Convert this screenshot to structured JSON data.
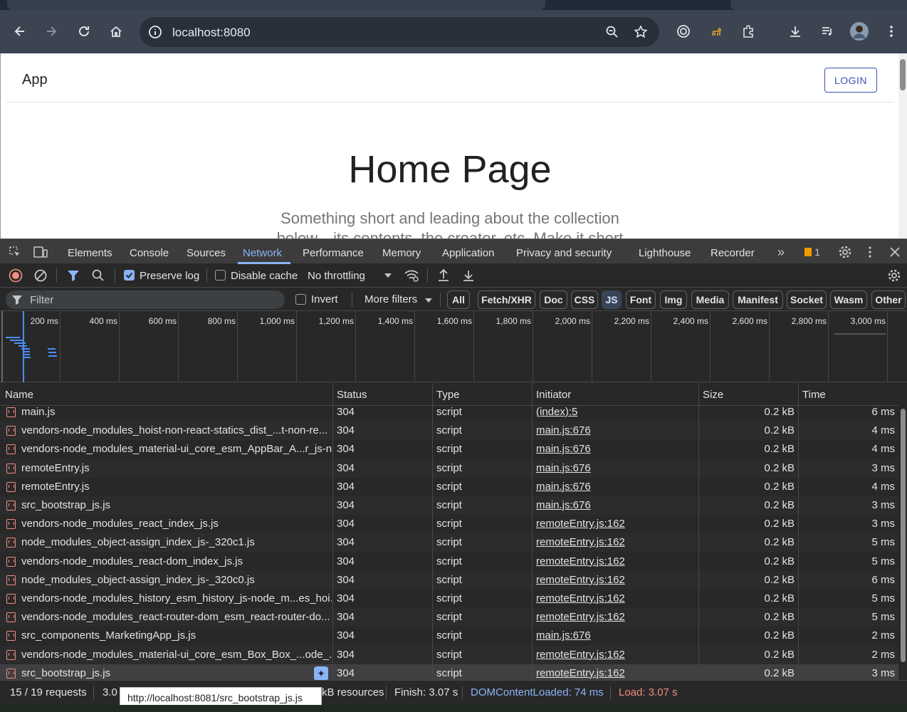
{
  "browser": {
    "url": "localhost:8080"
  },
  "page": {
    "app_title": "App",
    "login_label": "LOGIN",
    "heading": "Home Page",
    "subtitle": "Something short and leading about the collection below—its contents, the creator, etc. Make it short"
  },
  "devtools": {
    "tabs": [
      "Elements",
      "Console",
      "Sources",
      "Network",
      "Performance",
      "Memory",
      "Application",
      "Privacy and security",
      "Lighthouse",
      "Recorder"
    ],
    "active_tab": "Network",
    "issues_count": "1",
    "toolbar": {
      "preserve_log": "Preserve log",
      "disable_cache": "Disable cache",
      "throttling": "No throttling"
    },
    "filter": {
      "placeholder": "Filter",
      "invert": "Invert",
      "more_filters": "More filters",
      "types": [
        "All",
        "Fetch/XHR",
        "Doc",
        "CSS",
        "JS",
        "Font",
        "Img",
        "Media",
        "Manifest",
        "Socket",
        "Wasm",
        "Other"
      ],
      "active_type": "JS"
    },
    "timeline_labels": [
      "200 ms",
      "400 ms",
      "600 ms",
      "800 ms",
      "1,000 ms",
      "1,200 ms",
      "1,400 ms",
      "1,600 ms",
      "1,800 ms",
      "2,000 ms",
      "2,200 ms",
      "2,400 ms",
      "2,600 ms",
      "2,800 ms",
      "3,000 ms"
    ],
    "columns": {
      "name": "Name",
      "status": "Status",
      "type": "Type",
      "initiator": "Initiator",
      "size": "Size",
      "time": "Time"
    },
    "rows": [
      {
        "name": "main.js",
        "status": "304",
        "type": "script",
        "initiator": "(index):5",
        "size": "0.2 kB",
        "time": "6 ms"
      },
      {
        "name": "vendors-node_modules_hoist-non-react-statics_dist_...t-non-re...",
        "status": "304",
        "type": "script",
        "initiator": "main.js:676",
        "size": "0.2 kB",
        "time": "4 ms"
      },
      {
        "name": "vendors-node_modules_material-ui_core_esm_AppBar_A...r_js-n...",
        "status": "304",
        "type": "script",
        "initiator": "main.js:676",
        "size": "0.2 kB",
        "time": "4 ms"
      },
      {
        "name": "remoteEntry.js",
        "status": "304",
        "type": "script",
        "initiator": "main.js:676",
        "size": "0.2 kB",
        "time": "3 ms"
      },
      {
        "name": "remoteEntry.js",
        "status": "304",
        "type": "script",
        "initiator": "main.js:676",
        "size": "0.2 kB",
        "time": "4 ms"
      },
      {
        "name": "src_bootstrap_js.js",
        "status": "304",
        "type": "script",
        "initiator": "main.js:676",
        "size": "0.2 kB",
        "time": "3 ms"
      },
      {
        "name": "vendors-node_modules_react_index_js.js",
        "status": "304",
        "type": "script",
        "initiator": "remoteEntry.js:162",
        "size": "0.2 kB",
        "time": "3 ms"
      },
      {
        "name": "node_modules_object-assign_index_js-_320c1.js",
        "status": "304",
        "type": "script",
        "initiator": "remoteEntry.js:162",
        "size": "0.2 kB",
        "time": "5 ms"
      },
      {
        "name": "vendors-node_modules_react-dom_index_js.js",
        "status": "304",
        "type": "script",
        "initiator": "remoteEntry.js:162",
        "size": "0.2 kB",
        "time": "5 ms"
      },
      {
        "name": "node_modules_object-assign_index_js-_320c0.js",
        "status": "304",
        "type": "script",
        "initiator": "remoteEntry.js:162",
        "size": "0.2 kB",
        "time": "6 ms"
      },
      {
        "name": "vendors-node_modules_history_esm_history_js-node_m...es_hoi...",
        "status": "304",
        "type": "script",
        "initiator": "remoteEntry.js:162",
        "size": "0.2 kB",
        "time": "5 ms"
      },
      {
        "name": "vendors-node_modules_react-router-dom_esm_react-router-do...",
        "status": "304",
        "type": "script",
        "initiator": "remoteEntry.js:162",
        "size": "0.2 kB",
        "time": "5 ms"
      },
      {
        "name": "src_components_MarketingApp_js.js",
        "status": "304",
        "type": "script",
        "initiator": "main.js:676",
        "size": "0.2 kB",
        "time": "2 ms"
      },
      {
        "name": "vendors-node_modules_material-ui_core_esm_Box_Box_...ode_...",
        "status": "304",
        "type": "script",
        "initiator": "remoteEntry.js:162",
        "size": "0.2 kB",
        "time": "2 ms"
      },
      {
        "name": "src_bootstrap_js.js",
        "status": "304",
        "type": "script",
        "initiator": "remoteEntry.js:162",
        "size": "0.2 kB",
        "time": "3 ms"
      }
    ],
    "status_bar": {
      "requests": "15 / 19 requests",
      "transferred_prefix": "3.0",
      "resources_suffix": "kB resources",
      "finish": "Finish: 3.07 s",
      "dom_content_loaded": "DOMContentLoaded: 74 ms",
      "load": "Load: 3.07 s"
    },
    "tooltip": "http://localhost:8081/src_bootstrap_js.js"
  },
  "colors": {
    "accent": "#8ab4f8",
    "login_border": "#3f51b5",
    "dcl_color": "#8ab4f8",
    "load_color": "#f28b82"
  }
}
